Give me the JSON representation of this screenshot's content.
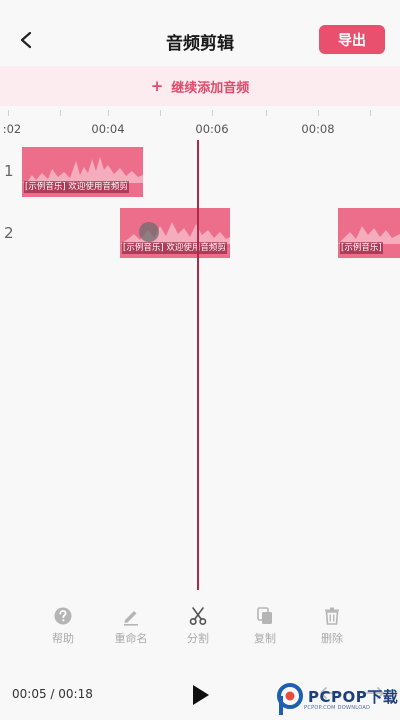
{
  "header": {
    "title": "音频剪辑",
    "export_label": "导出"
  },
  "add_bar": {
    "plus": "+",
    "label": "继续添加音频"
  },
  "ruler": {
    "labels": [
      ":02",
      "00:04",
      "00:06",
      "00:08"
    ]
  },
  "tracks": [
    {
      "number": "1",
      "clips": [
        {
          "label": "[示例音乐] 欢迎使用音频剪"
        }
      ]
    },
    {
      "number": "2",
      "clips": [
        {
          "label": "[示例音乐] 欢迎使用音频剪"
        },
        {
          "label": "[示例音乐]"
        }
      ]
    }
  ],
  "toolbar": [
    {
      "icon": "help-icon",
      "label": "帮助"
    },
    {
      "icon": "pencil-icon",
      "label": "重命名"
    },
    {
      "icon": "scissors-icon",
      "label": "分割"
    },
    {
      "icon": "copy-icon",
      "label": "复制"
    },
    {
      "icon": "trash-icon",
      "label": "删除"
    }
  ],
  "playback": {
    "time": "00:05 / 00:18"
  },
  "watermark": {
    "text": "PCPOP下载",
    "sub": "PCPOP.COM DOWNLOAD"
  },
  "colors": {
    "accent": "#e8506e",
    "clip": "#ec6e8a",
    "playhead": "#b0284a",
    "add_bar_bg": "#fcecf0"
  }
}
